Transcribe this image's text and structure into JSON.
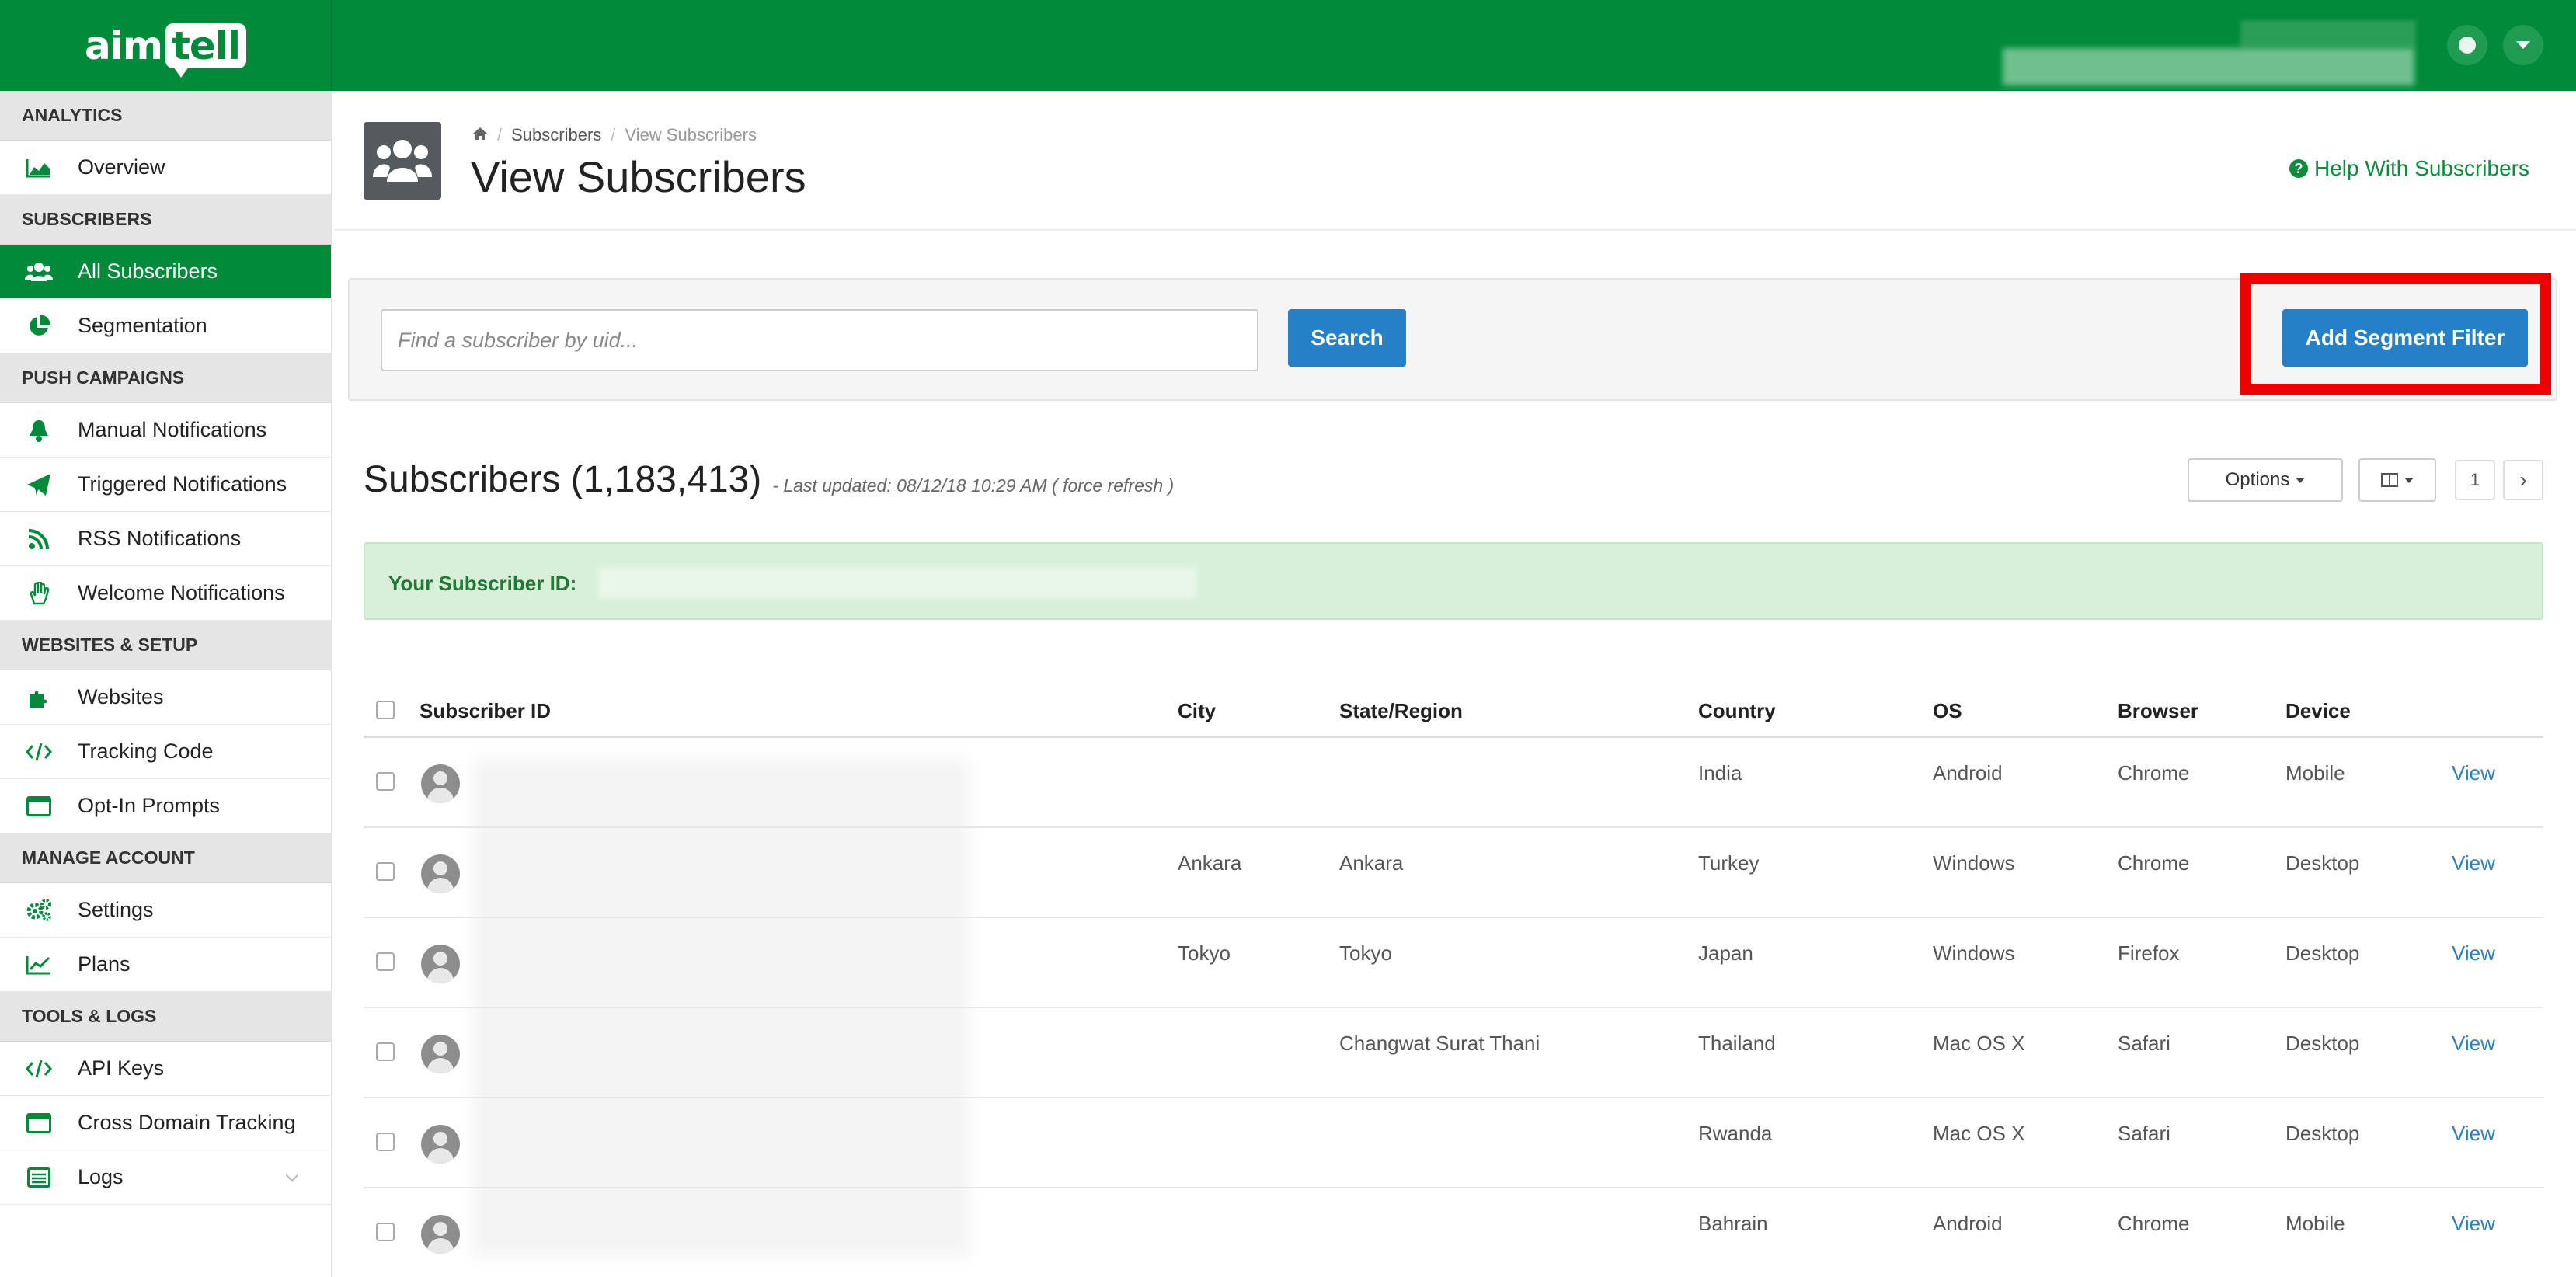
{
  "brand": {
    "logo_part1": "aim",
    "logo_part2": "tell",
    "primary_color": "#008a3a",
    "button_color": "#2680c8",
    "highlight_color": "#ee0000"
  },
  "sidebar": {
    "sections": [
      {
        "header": "ANALYTICS",
        "items": [
          {
            "label": "Overview",
            "icon": "area-chart-icon",
            "active": false
          }
        ]
      },
      {
        "header": "SUBSCRIBERS",
        "items": [
          {
            "label": "All Subscribers",
            "icon": "users-icon",
            "active": true
          },
          {
            "label": "Segmentation",
            "icon": "pie-chart-icon",
            "active": false
          }
        ]
      },
      {
        "header": "PUSH CAMPAIGNS",
        "items": [
          {
            "label": "Manual Notifications",
            "icon": "bell-icon",
            "active": false
          },
          {
            "label": "Triggered Notifications",
            "icon": "paper-plane-icon",
            "active": false
          },
          {
            "label": "RSS Notifications",
            "icon": "rss-icon",
            "active": false
          },
          {
            "label": "Welcome Notifications",
            "icon": "hand-wave-icon",
            "active": false
          }
        ]
      },
      {
        "header": "WEBSITES & SETUP",
        "items": [
          {
            "label": "Websites",
            "icon": "puzzle-icon",
            "active": false
          },
          {
            "label": "Tracking Code",
            "icon": "code-icon",
            "active": false
          },
          {
            "label": "Opt-In Prompts",
            "icon": "window-icon",
            "active": false
          }
        ]
      },
      {
        "header": "MANAGE ACCOUNT",
        "items": [
          {
            "label": "Settings",
            "icon": "gears-icon",
            "active": false
          },
          {
            "label": "Plans",
            "icon": "line-chart-icon",
            "active": false
          }
        ]
      },
      {
        "header": "TOOLS & LOGS",
        "items": [
          {
            "label": "API Keys",
            "icon": "code-icon",
            "active": false
          },
          {
            "label": "Cross Domain Tracking",
            "icon": "window-icon",
            "active": false
          },
          {
            "label": "Logs",
            "icon": "list-icon",
            "active": false
          }
        ]
      }
    ]
  },
  "header": {
    "breadcrumb": {
      "home_icon": "home-icon",
      "subscribers": "Subscribers",
      "current": "View Subscribers"
    },
    "title": "View Subscribers",
    "help_link": "Help With Subscribers",
    "help_icon_glyph": "?"
  },
  "search": {
    "placeholder": "Find a subscriber by uid...",
    "value": "",
    "button_label": "Search"
  },
  "segment_button": "Add Segment Filter",
  "subscribers": {
    "title": "Subscribers (1,183,413)",
    "last_updated": "- Last updated: 08/12/18 10:29 AM ( force refresh )",
    "options_label": "Options",
    "page": "1",
    "next_glyph": "›"
  },
  "alert": {
    "label": "Your Subscriber ID:"
  },
  "table": {
    "headers": {
      "subscriber_id": "Subscriber ID",
      "city": "City",
      "state": "State/Region",
      "country": "Country",
      "os": "OS",
      "browser": "Browser",
      "device": "Device"
    },
    "rows": [
      {
        "city": "",
        "state": "",
        "country": "India",
        "os": "Android",
        "browser": "Chrome",
        "device": "Mobile",
        "action": "View"
      },
      {
        "city": "Ankara",
        "state": "Ankara",
        "country": "Turkey",
        "os": "Windows",
        "browser": "Chrome",
        "device": "Desktop",
        "action": "View"
      },
      {
        "city": "Tokyo",
        "state": "Tokyo",
        "country": "Japan",
        "os": "Windows",
        "browser": "Firefox",
        "device": "Desktop",
        "action": "View"
      },
      {
        "city": "",
        "state": "Changwat Surat Thani",
        "country": "Thailand",
        "os": "Mac OS X",
        "browser": "Safari",
        "device": "Desktop",
        "action": "View"
      },
      {
        "city": "",
        "state": "",
        "country": "Rwanda",
        "os": "Mac OS X",
        "browser": "Safari",
        "device": "Desktop",
        "action": "View"
      },
      {
        "city": "",
        "state": "",
        "country": "Bahrain",
        "os": "Android",
        "browser": "Chrome",
        "device": "Mobile",
        "action": "View"
      }
    ]
  }
}
